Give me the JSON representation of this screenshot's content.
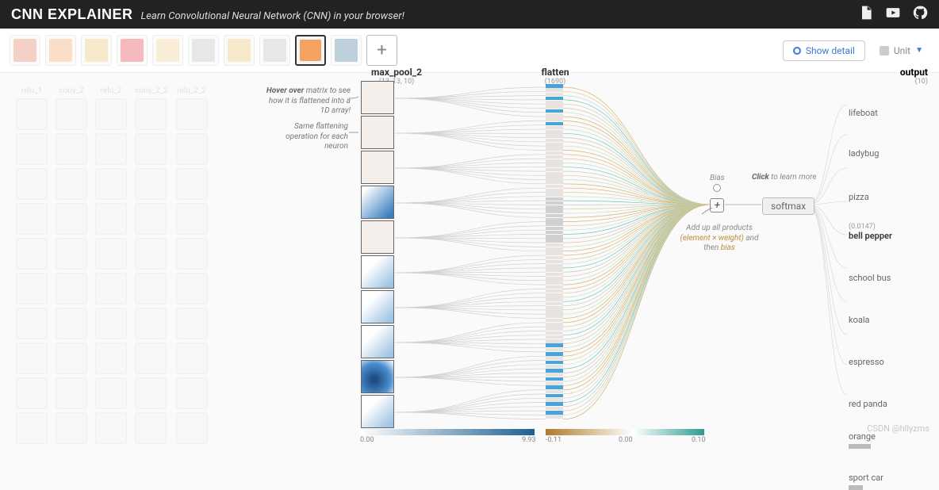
{
  "header": {
    "brand": "CNN EXPLAINER",
    "tagline": "Learn Convolutional Neural Network (CNN) in your browser!"
  },
  "toolbar": {
    "show_detail": "Show detail",
    "unit_label": "Unit",
    "add_glyph": "+"
  },
  "thumbs": [
    {
      "name": "lifeboat",
      "color": "#e07a5f"
    },
    {
      "name": "ladybug",
      "color": "#f4a261"
    },
    {
      "name": "pizza",
      "color": "#e9c46a"
    },
    {
      "name": "bell pepper",
      "color": "#e63946"
    },
    {
      "name": "school bus",
      "color": "#f2cc8f"
    },
    {
      "name": "koala",
      "color": "#bdbdbd"
    },
    {
      "name": "espresso",
      "color": "#e9c46a"
    },
    {
      "name": "red panda",
      "color": "#bdbdbd"
    },
    {
      "name": "orange",
      "color": "#f4a261"
    },
    {
      "name": "sport car",
      "color": "#457b9d"
    }
  ],
  "selected_thumb_index": 8,
  "faded_layer_labels": [
    "relu_1",
    "conv_2",
    "relu_2",
    "conv_2_2",
    "relu_2_2"
  ],
  "layers": {
    "maxpool": {
      "title": "max_pool_2",
      "shape": "(13, 13, 10)"
    },
    "flatten": {
      "title": "flatten",
      "shape": "(1690)"
    },
    "output": {
      "title": "output",
      "shape": "(10)"
    }
  },
  "annotations": {
    "hover": "<strong>Hover over</strong> matrix to see how it is flattened into a 1D array!",
    "sameop": "Same flattening operation for each neuron",
    "bias": "Bias",
    "sum": "Add up all products <em>(element × weight)</em> and then <em>bias</em>",
    "clickmore": "<strong>Click</strong> to learn more"
  },
  "softmax_label": "softmax",
  "fm_styles": [
    "",
    "",
    "",
    "vblue",
    "",
    "lblue",
    "lblue",
    "lblue",
    "dblue",
    "lblue"
  ],
  "colorbar1": {
    "min": "0.00",
    "max": "9.93"
  },
  "colorbar2": {
    "min": "-0.11",
    "mid": "0.00",
    "max": "0.10"
  },
  "outputs": [
    {
      "label": "lifeboat",
      "bar": 0
    },
    {
      "label": "ladybug",
      "bar": 0
    },
    {
      "label": "pizza",
      "bar": 0
    },
    {
      "label": "bell pepper",
      "bar": 0,
      "selected": true,
      "score": "(0.0147)"
    },
    {
      "label": "school bus",
      "bar": 0
    },
    {
      "label": "koala",
      "bar": 0
    },
    {
      "label": "espresso",
      "bar": 0
    },
    {
      "label": "red panda",
      "bar": 0
    },
    {
      "label": "orange",
      "bar": 28
    },
    {
      "label": "sport car",
      "bar": 18
    }
  ],
  "watermark": "CSDN @hllyzms"
}
